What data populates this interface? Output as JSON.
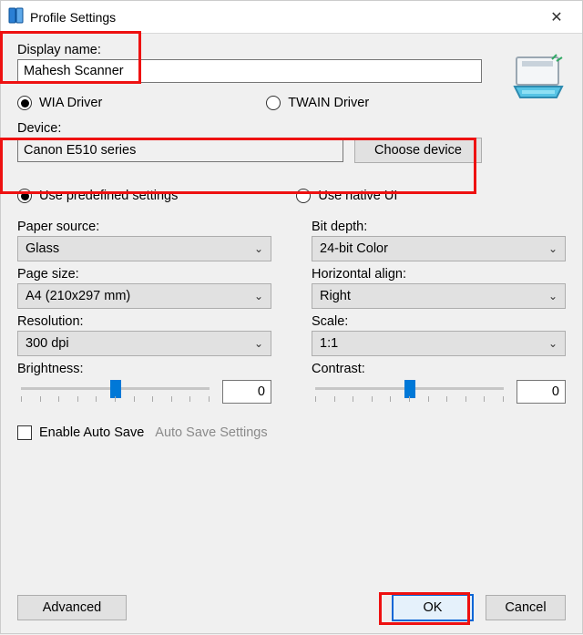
{
  "window": {
    "title": "Profile Settings",
    "close_label": "✕"
  },
  "labels": {
    "display_name": "Display name:",
    "device": "Device:",
    "paper_source": "Paper source:",
    "page_size": "Page size:",
    "resolution": "Resolution:",
    "brightness": "Brightness:",
    "bit_depth": "Bit depth:",
    "horizontal_align": "Horizontal align:",
    "scale": "Scale:",
    "contrast": "Contrast:"
  },
  "values": {
    "display_name": "Mahesh Scanner",
    "device": "Canon E510 series",
    "paper_source": "Glass",
    "page_size": "A4 (210x297 mm)",
    "resolution": "300 dpi",
    "brightness": "0",
    "bit_depth": "24-bit Color",
    "horizontal_align": "Right",
    "scale": "1:1",
    "contrast": "0"
  },
  "radios": {
    "driver": {
      "wia": "WIA Driver",
      "twain": "TWAIN Driver",
      "selected": "wia"
    },
    "settings_mode": {
      "predefined": "Use predefined settings",
      "native": "Use native UI",
      "selected": "predefined"
    }
  },
  "buttons": {
    "choose_device": "Choose device",
    "advanced": "Advanced",
    "ok": "OK",
    "cancel": "Cancel"
  },
  "autosave": {
    "enable_label": "Enable Auto Save",
    "settings_label": "Auto Save Settings",
    "checked": false
  },
  "icons": {
    "app": "profile-settings-app-icon",
    "scanner": "scanner-icon",
    "chevron": "⌄"
  }
}
